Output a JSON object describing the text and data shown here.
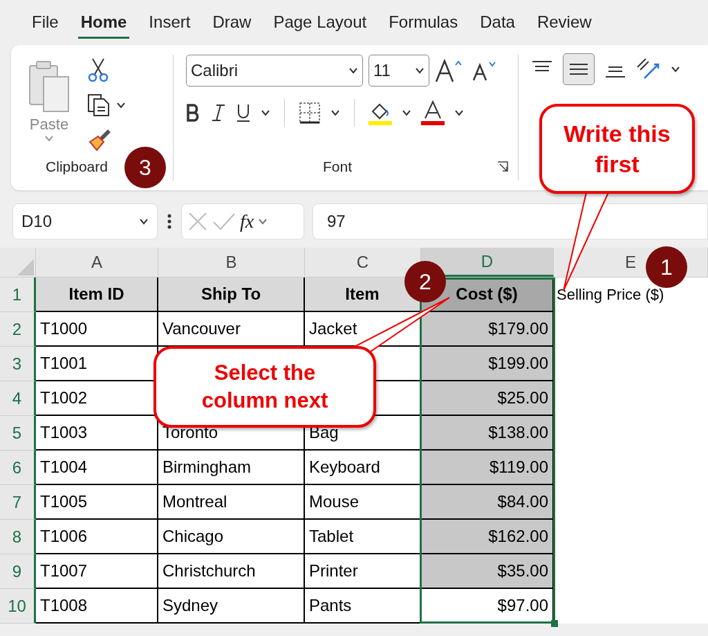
{
  "ribbon_tabs": [
    {
      "label": "File",
      "selected": false
    },
    {
      "label": "Home",
      "selected": true
    },
    {
      "label": "Insert",
      "selected": false
    },
    {
      "label": "Draw",
      "selected": false
    },
    {
      "label": "Page Layout",
      "selected": false
    },
    {
      "label": "Formulas",
      "selected": false
    },
    {
      "label": "Data",
      "selected": false
    },
    {
      "label": "Review",
      "selected": false
    }
  ],
  "clipboard": {
    "paste_label": "Paste",
    "group_label": "Clipboard"
  },
  "font_group": {
    "font_name": "Calibri",
    "font_size": "11",
    "group_label": "Font"
  },
  "formula_bar": {
    "name_box": "D10",
    "function_label": "fx",
    "formula": "97"
  },
  "columns": [
    {
      "label": "A",
      "selected": false
    },
    {
      "label": "B",
      "selected": false
    },
    {
      "label": "C",
      "selected": false
    },
    {
      "label": "D",
      "selected": true
    },
    {
      "label": "E",
      "selected": false
    }
  ],
  "rows": [
    {
      "number": "1",
      "kind": "header",
      "active": false,
      "cells": [
        "Item ID",
        "Ship To",
        "Item",
        "Cost ($)",
        "Selling Price ($)"
      ]
    },
    {
      "number": "2",
      "kind": "data",
      "active": false,
      "cells": [
        "T1000",
        "Vancouver",
        "Jacket",
        "$179.00",
        ""
      ]
    },
    {
      "number": "3",
      "kind": "data",
      "active": false,
      "cells": [
        "T1001",
        "",
        "",
        "$199.00",
        ""
      ]
    },
    {
      "number": "4",
      "kind": "data",
      "active": false,
      "cells": [
        "T1002",
        "",
        "",
        "$25.00",
        ""
      ]
    },
    {
      "number": "5",
      "kind": "data",
      "active": false,
      "cells": [
        "T1003",
        "Toronto",
        "Bag",
        "$138.00",
        ""
      ]
    },
    {
      "number": "6",
      "kind": "data",
      "active": false,
      "cells": [
        "T1004",
        "Birmingham",
        "Keyboard",
        "$119.00",
        ""
      ]
    },
    {
      "number": "7",
      "kind": "data",
      "active": false,
      "cells": [
        "T1005",
        "Montreal",
        "Mouse",
        "$84.00",
        ""
      ]
    },
    {
      "number": "8",
      "kind": "data",
      "active": false,
      "cells": [
        "T1006",
        "Chicago",
        "Tablet",
        "$162.00",
        ""
      ]
    },
    {
      "number": "9",
      "kind": "data",
      "active": false,
      "cells": [
        "T1007",
        "Christchurch",
        "Printer",
        "$35.00",
        ""
      ]
    },
    {
      "number": "10",
      "kind": "data",
      "active": true,
      "cells": [
        "T1008",
        "Sydney",
        "Pants",
        "$97.00",
        ""
      ]
    }
  ],
  "callouts": [
    {
      "text": "Write this first"
    },
    {
      "text": "Select the column next"
    }
  ],
  "badges": [
    "1",
    "2",
    "3"
  ]
}
